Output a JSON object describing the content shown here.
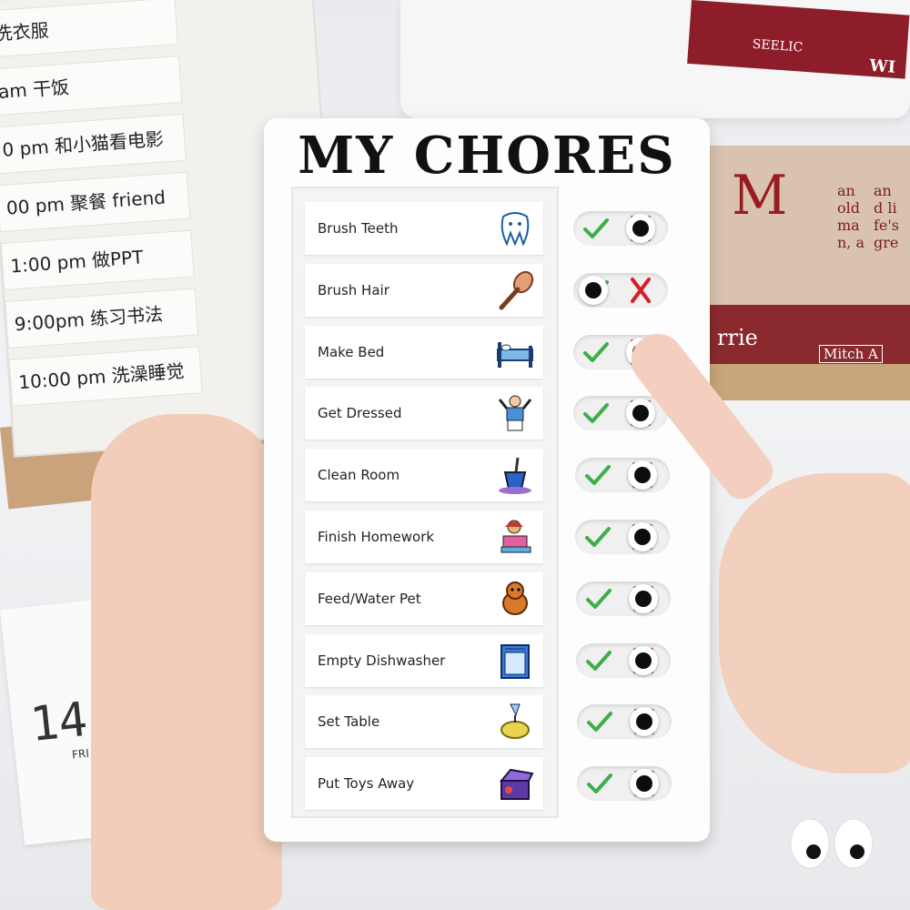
{
  "board": {
    "title": "MY CHORES",
    "chores": [
      {
        "label": "Brush Teeth",
        "icon": "tooth-icon",
        "status": "done"
      },
      {
        "label": "Brush Hair",
        "icon": "hairbrush-icon",
        "status": "not-done"
      },
      {
        "label": "Make Bed",
        "icon": "bed-icon",
        "status": "done"
      },
      {
        "label": "Get Dressed",
        "icon": "clothes-icon",
        "status": "done"
      },
      {
        "label": "Clean Room",
        "icon": "bucket-icon",
        "status": "done"
      },
      {
        "label": "Finish Homework",
        "icon": "homework-icon",
        "status": "done"
      },
      {
        "label": "Feed/Water Pet",
        "icon": "pet-icon",
        "status": "done"
      },
      {
        "label": "Empty Dishwasher",
        "icon": "dishwasher-icon",
        "status": "done"
      },
      {
        "label": "Set Table",
        "icon": "plate-icon",
        "status": "done"
      },
      {
        "label": "Put Toys Away",
        "icon": "toybox-icon",
        "status": "done"
      }
    ]
  },
  "background": {
    "left_board_rows": [
      "洗衣服",
      "am 干饭",
      "0 pm 和小猫看电影",
      "00 pm 聚餐 friend",
      "1:00 pm 做PPT",
      "9:00pm 练习书法",
      "10:00 pm 洗澡睡觉"
    ],
    "calendar_day": "14",
    "calendar_weekday": "FRI",
    "book_texts": [
      "SEELIC",
      "WI",
      "an old man, a",
      "and life's gre",
      "rrie",
      "Mitch A"
    ]
  },
  "colors": {
    "check_green": "#3fae4a",
    "cross_red": "#d61f26",
    "board_white": "#fdfdfd",
    "knob_black": "#0d0d0d"
  }
}
